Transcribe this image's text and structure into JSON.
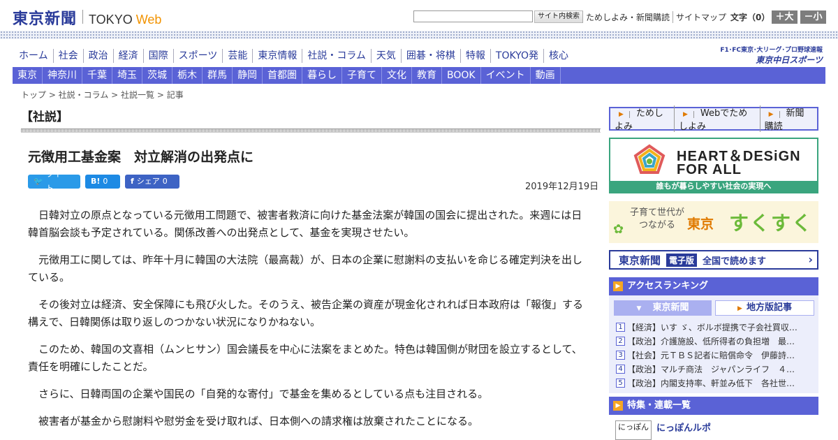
{
  "header": {
    "logo_jp": "東京新聞",
    "logo_tokyo": "TOKYO",
    "logo_web": "Web",
    "search_button": "サイト内検索",
    "links": [
      "ためしよみ・新聞購読",
      "サイトマップ"
    ],
    "fontsize_label": "文字（0）",
    "fontsize_bigger": "＋大",
    "fontsize_smaller": "－小"
  },
  "main_nav": [
    "ホーム",
    "社会",
    "政治",
    "経済",
    "国際",
    "スポーツ",
    "芸能",
    "東京情報",
    "社説・コラム",
    "天気",
    "囲碁・将棋",
    "特報",
    "TOKYO発",
    "核心"
  ],
  "chunichi": {
    "line1": "F1･FC東京･大リーグ･プロ野球速報",
    "line2": "東京中日スポーツ"
  },
  "sub_nav": [
    "東京",
    "神奈川",
    "千葉",
    "埼玉",
    "茨城",
    "栃木",
    "群馬",
    "静岡",
    "首都圏",
    "暮らし",
    "子育て",
    "文化",
    "教育",
    "BOOK",
    "イベント",
    "動画"
  ],
  "breadcrumb": "トップ > 社説・コラム > 社説一覧 > 記事",
  "article": {
    "section": "【社説】",
    "title": "元徴用工基金案　対立解消の出発点に",
    "date": "2019年12月19日",
    "share": {
      "tweet": "ツイート",
      "hatena_icon": "B!",
      "hatena_count": "0",
      "fb_label": "シェア",
      "fb_count": "0"
    },
    "paragraphs": [
      "日韓対立の原点となっている元徴用工問題で、被害者救済に向けた基金法案が韓国の国会に提出された。来週には日韓首脳会談も予定されている。関係改善への出発点として、基金を実現させたい。",
      "元徴用工に関しては、昨年十月に韓国の大法院（最高裁）が、日本の企業に慰謝料の支払いを命じる確定判決を出している。",
      "その後対立は経済、安全保障にも飛び火した。そのうえ、被告企業の資産が現金化されれば日本政府は「報復」する構えで、日韓関係は取り返しのつかない状況になりかねない。",
      "このため、韓国の文喜相（ムンヒサン）国会議長を中心に法案をまとめた。特色は韓国側が財団を設立するとして、責任を明確にしたことだ。",
      "さらに、日韓両国の企業や国民の「自発的な寄付」で基金を集めるとしている点も注目される。",
      "被害者が基金から慰謝料や慰労金を受け取れば、日本側への請求権は放棄されたことになる。"
    ]
  },
  "sidebar": {
    "links": [
      "ためしよみ",
      "Webでためしよみ",
      "新聞購読"
    ],
    "hd_banner": {
      "line1": "HEART＆DESiGN",
      "line2": "FOR ALL",
      "footer": "誰もが暮らしやすい社会の実現へ"
    },
    "sukusuku": {
      "small1": "子育て世代が",
      "small2": "つながる",
      "tokyo": "東京",
      "main": "すくすく"
    },
    "e_edition": {
      "logo": "東京新聞",
      "badge": "電子版",
      "text": "全国で読めます"
    },
    "ranking": {
      "heading": "アクセスランキング",
      "tab_active": "東京新聞",
      "tab_other": "地方版記事",
      "items": [
        {
          "num": "1",
          "text": "【経済】いす ゞ、ボルボ提携で子会社買収…"
        },
        {
          "num": "2",
          "text": "【政治】介護施設、低所得者の負担増　最…"
        },
        {
          "num": "3",
          "text": "【社会】元ＴＢＳ記者に賠償命令　伊藤詩…"
        },
        {
          "num": "4",
          "text": "【政治】マルチ商法　ジャパンライフ　４…"
        },
        {
          "num": "5",
          "text": "【政治】内閣支持率、軒並み低下　各社世…"
        }
      ]
    },
    "features": {
      "heading": "特集・連載一覧",
      "thumb": "にっぽん",
      "title": "にっぽんルポ"
    }
  }
}
